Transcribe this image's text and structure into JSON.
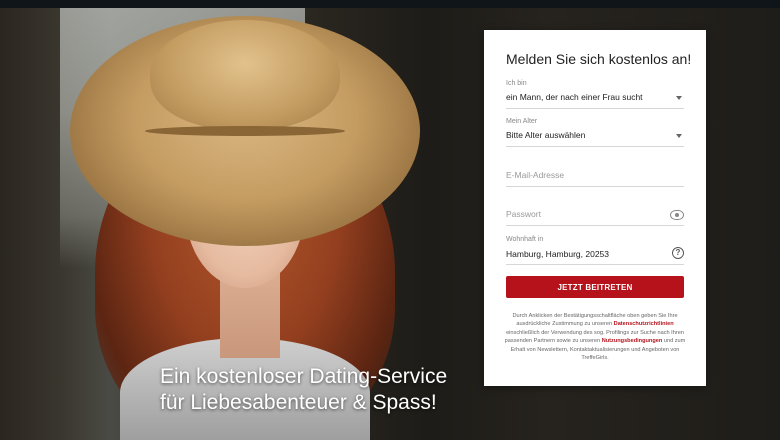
{
  "hero": {
    "headline_line1": "Ein kostenloser Dating-Service",
    "headline_line2": "für Liebesabenteuer & Spass!"
  },
  "form": {
    "title": "Melden Sie sich kostenlos an!",
    "seeking": {
      "label": "Ich bin",
      "value": "ein Mann, der nach einer Frau sucht"
    },
    "age": {
      "label": "Mein Alter",
      "value": "Bitte Alter auswählen"
    },
    "email": {
      "placeholder": "E-Mail-Adresse"
    },
    "password": {
      "placeholder": "Passwort"
    },
    "location": {
      "label": "Wohnhaft in",
      "value": "Hamburg, Hamburg, 20253"
    },
    "submit_label": "JETZT BEITRETEN",
    "legal": {
      "part1": "Durch Anklicken der Bestätigungsschaltfläche oben geben Sie Ihre ausdrückliche Zustimmung zu unseren",
      "privacy_link": "Datenschutzrichtlinien",
      "part2": "einschließlich der Verwendung des sog. Profilings zur Suche nach Ihren passenden Partnern sowie zu unseren",
      "terms_link": "Nutzungsbedingungen",
      "part3": "und zum Erhalt von Newslettern, Kontaktaktualisierungen und Angeboten von TreffeGirls."
    }
  },
  "colors": {
    "accent": "#b5121b",
    "form_bg": "#ffffff",
    "topbar": "#0f1519"
  }
}
